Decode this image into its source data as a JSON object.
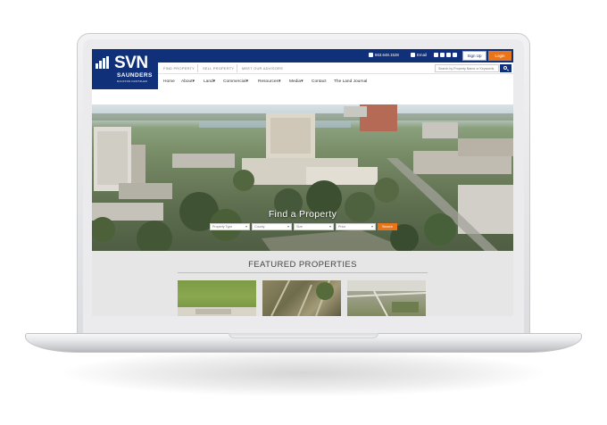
{
  "logo": {
    "mark": "SVN",
    "name": "SAUNDERS",
    "tagline": "RALSTON DANTZLER"
  },
  "topbar": {
    "phone": "863.648.1528",
    "email_label": "Email",
    "social_icons": [
      "facebook-icon",
      "twitter-icon",
      "linkedin-icon",
      "youtube-icon"
    ],
    "signup_label": "Sign Up",
    "login_label": "Login"
  },
  "subbar": {
    "links": [
      "FIND PROPERTY",
      "SELL PROPERTY",
      "MEET OUR ADVISORS"
    ],
    "search_placeholder": "Search by Property Name or Keywords"
  },
  "nav": {
    "items": [
      "Home",
      "About",
      "Land",
      "Commercial",
      "Resources",
      "Media",
      "Contact",
      "The Land Journal"
    ],
    "dropdown_caret": "▾"
  },
  "hero": {
    "title": "Find a Property",
    "filters": [
      "Property Type",
      "County",
      "Size",
      "Price"
    ],
    "search_label": "Search"
  },
  "featured": {
    "title": "FEATURED PROPERTIES"
  },
  "colors": {
    "brand_navy": "#10307a",
    "accent_orange": "#e8751a"
  }
}
